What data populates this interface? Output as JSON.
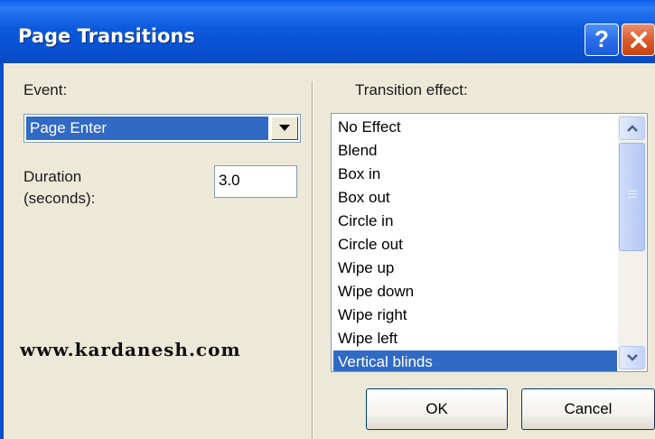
{
  "window": {
    "title": "Page Transitions",
    "help_glyph": "?"
  },
  "left_panel": {
    "event_label": "Event:",
    "event_value": "Page Enter",
    "duration_label_line1": "Duration",
    "duration_label_line2": "(seconds):",
    "duration_value": "3.0",
    "watermark": "www.kardanesh.com"
  },
  "right_panel": {
    "effect_label": "Transition effect:",
    "effects": [
      "No Effect",
      "Blend",
      "Box in",
      "Box out",
      "Circle in",
      "Circle out",
      "Wipe up",
      "Wipe down",
      "Wipe right",
      "Wipe left",
      "Vertical blinds"
    ],
    "selected_index": 10
  },
  "buttons": {
    "ok_label": "OK",
    "cancel_label": "Cancel"
  },
  "colors": {
    "titlebar": "#0a58d8",
    "selection": "#316ac5",
    "dialog_bg": "#ece9d8"
  }
}
